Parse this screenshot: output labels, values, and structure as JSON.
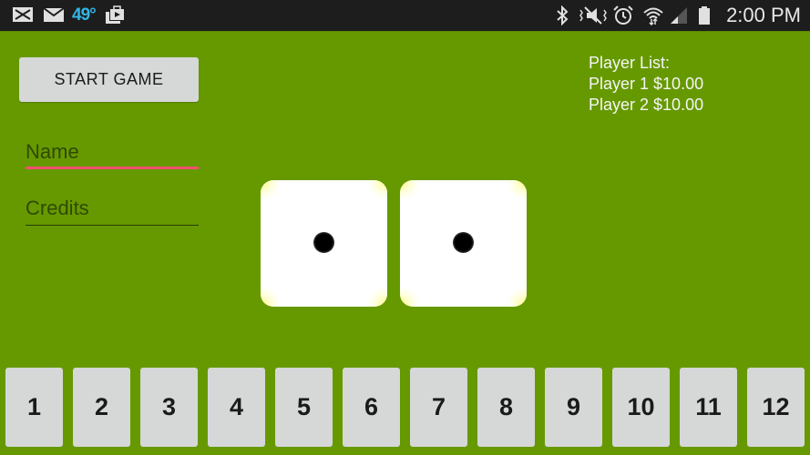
{
  "status_bar": {
    "left_icons": [
      "missed-call-icon",
      "email-icon",
      "weather-temp",
      "media-icon"
    ],
    "temperature": "49°",
    "right_icons": [
      "bluetooth-icon",
      "vibrate-mute-icon",
      "alarm-icon",
      "wifi-icon",
      "signal-icon",
      "battery-icon"
    ],
    "time": "2:00 PM"
  },
  "controls": {
    "start_button_label": "START GAME",
    "name_placeholder": "Name",
    "credits_placeholder": "Credits"
  },
  "player_list": {
    "title": "Player List:",
    "players": [
      "Player 1 $10.00",
      "Player 2 $10.00"
    ]
  },
  "dice": [
    {
      "value": 1
    },
    {
      "value": 1
    }
  ],
  "number_buttons": [
    "1",
    "2",
    "3",
    "4",
    "5",
    "6",
    "7",
    "8",
    "9",
    "10",
    "11",
    "12"
  ],
  "colors": {
    "background": "#669900",
    "status_bar": "#1d1d1d",
    "temperature": "#33b5e5",
    "focused_underline": "#f0506e",
    "button": "#d6d7d7"
  }
}
